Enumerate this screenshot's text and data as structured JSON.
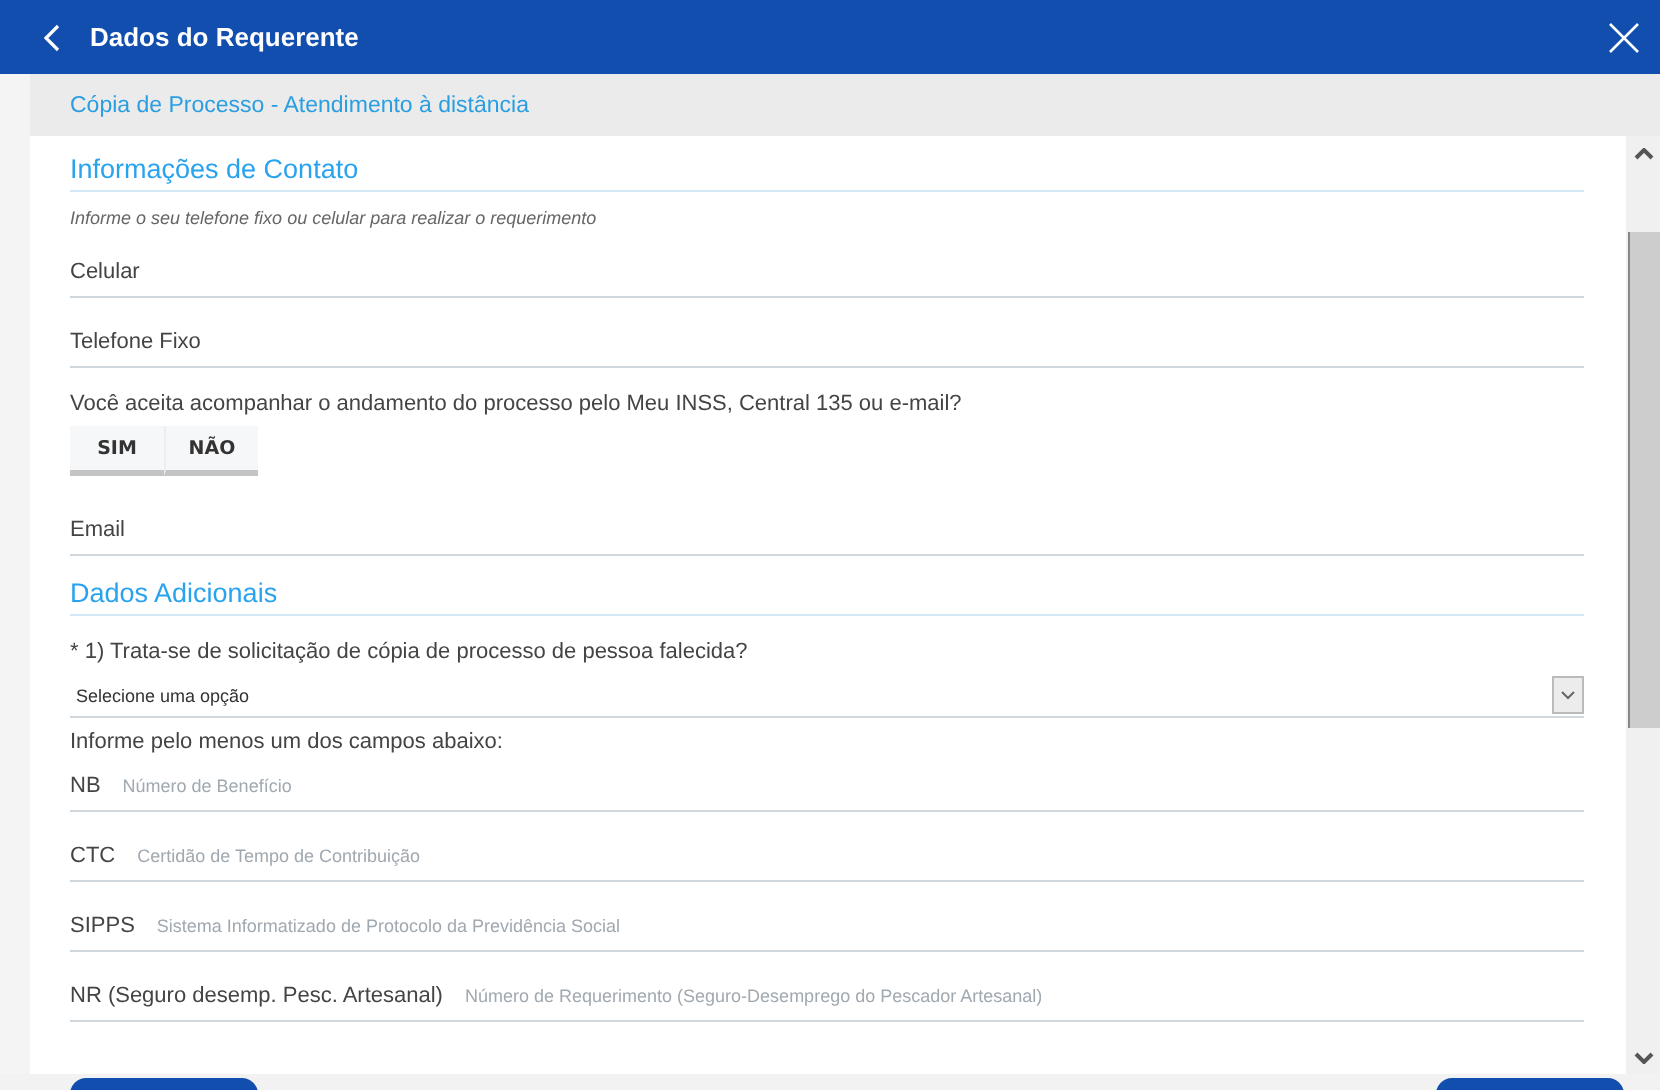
{
  "header": {
    "title": "Dados do Requerente"
  },
  "subtitle": "Cópia de Processo - Atendimento à distância",
  "sections": [
    {
      "title": "Informações de Contato",
      "items": [
        {
          "kind": "hint",
          "text": "Informe o seu telefone fixo ou celular para realizar o requerimento"
        },
        {
          "kind": "field",
          "label": "Celular"
        },
        {
          "kind": "field",
          "label": "Telefone Fixo"
        },
        {
          "kind": "question",
          "text": "Você aceita acompanhar o andamento do processo pelo Meu INSS, Central 135 ou e-mail?"
        },
        {
          "kind": "toggle",
          "options": [
            {
              "label": "SIM",
              "selected": false
            },
            {
              "label": "NÃO",
              "selected": false
            }
          ]
        },
        {
          "kind": "field",
          "label": "Email"
        }
      ]
    },
    {
      "title": "Dados Adicionais",
      "items": [
        {
          "kind": "question",
          "text": "* 1) Trata-se de solicitação de cópia de processo de pessoa falecida?"
        },
        {
          "kind": "select",
          "value": "Selecione uma opção"
        },
        {
          "kind": "question",
          "text": "Informe pelo menos um dos campos abaixo:"
        },
        {
          "kind": "field",
          "label": "NB",
          "placeholder": "Número de Benefício"
        },
        {
          "kind": "field",
          "label": "CTC",
          "placeholder": "Certidão de Tempo de Contribuição"
        },
        {
          "kind": "field",
          "label": "SIPPS",
          "placeholder": "Sistema Informatizado de Protocolo da Previdência Social"
        },
        {
          "kind": "field",
          "label": "NR (Seguro desemp. Pesc. Artesanal)",
          "placeholder": "Número de Requerimento (Seguro-Desemprego do Pescador Artesanal)"
        }
      ]
    }
  ]
}
